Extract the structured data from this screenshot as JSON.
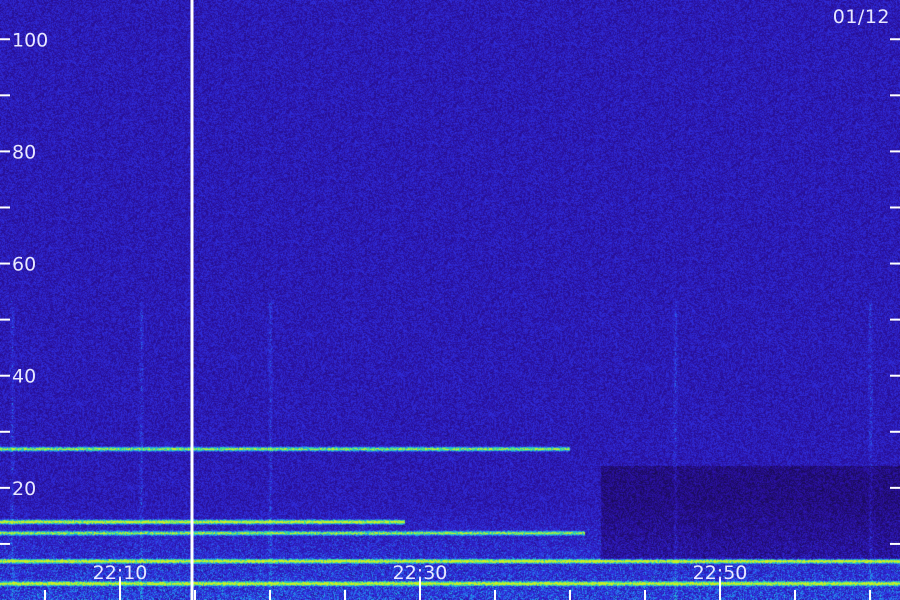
{
  "date_label": "01/12",
  "chart_data": {
    "type": "heatmap",
    "title": "",
    "xlabel": "",
    "ylabel": "",
    "ylim": [
      0,
      107
    ],
    "y_ticks_labeled": [
      20,
      40,
      60,
      80,
      100
    ],
    "y_ticks_minor": [
      10,
      30,
      50,
      70,
      90
    ],
    "x_ticks_labeled": [
      "22:10",
      "22:30",
      "22:50"
    ],
    "xlim_minutes": [
      22.0,
      82.0
    ],
    "x_ticks_labeled_minutes": [
      30,
      50,
      70
    ],
    "x_ticks_minor_minutes": [
      25,
      35,
      40,
      45,
      55,
      60,
      65,
      75,
      80
    ],
    "marker_line_minutes": 34.8,
    "colormap": [
      "#000018",
      "#1a0a52",
      "#2a10a0",
      "#3030e0",
      "#20a0f0",
      "#30e0a0",
      "#d0f020"
    ],
    "horizontal_bands": [
      {
        "freq": 27,
        "intensity": 0.75,
        "end_minutes": 60
      },
      {
        "freq": 14,
        "intensity": 0.9,
        "end_minutes": 49
      },
      {
        "freq": 12,
        "intensity": 0.7,
        "end_minutes": 61
      },
      {
        "freq": 7,
        "intensity": 0.85,
        "end_minutes": 82
      },
      {
        "freq": 3,
        "intensity": 0.8,
        "end_minutes": 82
      }
    ],
    "vertical_streaks_minutes": [
      22.8,
      31.4,
      40.0,
      67.0,
      80.0
    ]
  }
}
